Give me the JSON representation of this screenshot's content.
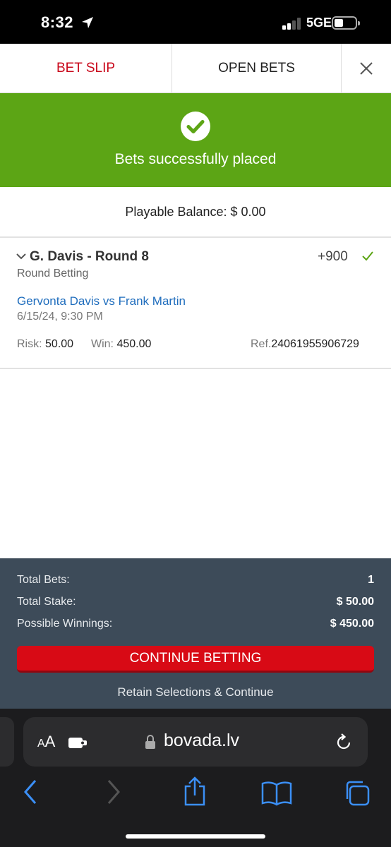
{
  "status_bar": {
    "time": "8:32",
    "network": "5GE"
  },
  "tabs": {
    "bet_slip": "BET SLIP",
    "open_bets": "OPEN BETS"
  },
  "success": {
    "message": "Bets successfully placed"
  },
  "balance": {
    "text": "Playable Balance: $ 0.00"
  },
  "bet": {
    "title": "G. Davis - Round 8",
    "odds": "+900",
    "market": "Round Betting",
    "event": "Gervonta Davis vs Frank Martin",
    "date": "6/15/24, 9:30 PM",
    "risk_label": "Risk:",
    "risk_value": "50.00",
    "win_label": "Win:",
    "win_value": "450.00",
    "ref_label": "Ref.",
    "ref_value": "24061955906729"
  },
  "summary": {
    "total_bets_label": "Total Bets:",
    "total_bets_value": "1",
    "total_stake_label": "Total Stake:",
    "total_stake_value": "$ 50.00",
    "possible_winnings_label": "Possible Winnings:",
    "possible_winnings_value": "$ 450.00",
    "continue_label": "CONTINUE BETTING",
    "retain_label": "Retain Selections & Continue"
  },
  "browser": {
    "aa_large": "A",
    "aa_small": "A",
    "url": "bovada.lv"
  },
  "colors": {
    "brand_red": "#d80a15",
    "success_green": "#5ca515",
    "link_blue": "#1f6dbd",
    "summary_bg": "#3d4b59"
  },
  "icons": [
    "location-arrow-icon",
    "signal-icon",
    "battery-icon",
    "close-icon",
    "checkmark-circle-icon",
    "chevron-down-icon",
    "checkmark-icon",
    "extension-icon",
    "lock-icon",
    "reload-icon",
    "back-icon",
    "forward-icon",
    "share-icon",
    "bookmarks-icon",
    "tabs-icon"
  ]
}
